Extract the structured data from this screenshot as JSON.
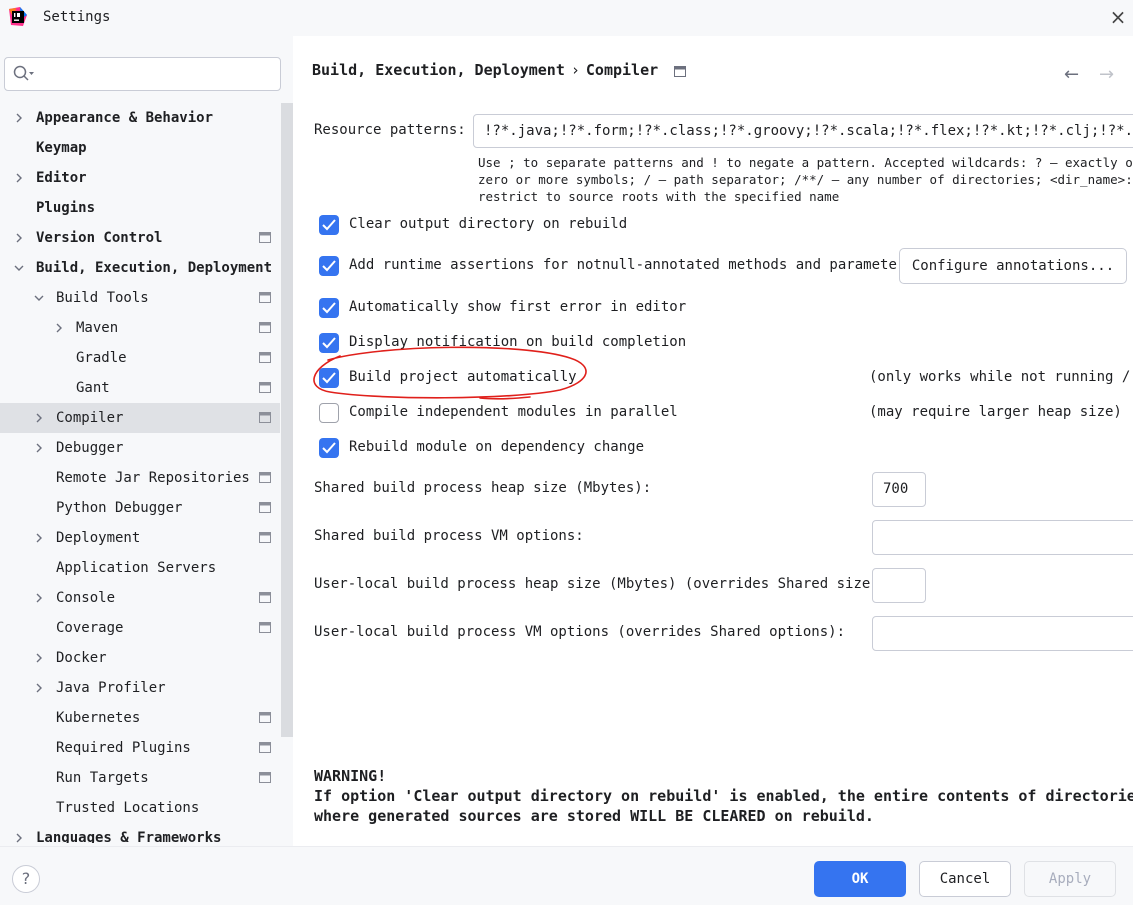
{
  "window": {
    "title": "Settings"
  },
  "search": {
    "placeholder": ""
  },
  "tree": [
    {
      "label": "Appearance & Behavior",
      "bold": true,
      "chevron": "right",
      "indent": 0,
      "proj": false,
      "selected": false
    },
    {
      "label": "Keymap",
      "bold": true,
      "chevron": "none",
      "indent": 0,
      "proj": false,
      "selected": false
    },
    {
      "label": "Editor",
      "bold": true,
      "chevron": "right",
      "indent": 0,
      "proj": false,
      "selected": false
    },
    {
      "label": "Plugins",
      "bold": true,
      "chevron": "none",
      "indent": 0,
      "proj": false,
      "selected": false
    },
    {
      "label": "Version Control",
      "bold": true,
      "chevron": "right",
      "indent": 0,
      "proj": true,
      "selected": false
    },
    {
      "label": "Build, Execution, Deployment",
      "bold": true,
      "chevron": "down",
      "indent": 0,
      "proj": false,
      "selected": false
    },
    {
      "label": "Build Tools",
      "bold": false,
      "chevron": "down",
      "indent": 1,
      "proj": true,
      "selected": false
    },
    {
      "label": "Maven",
      "bold": false,
      "chevron": "right",
      "indent": 2,
      "proj": true,
      "selected": false
    },
    {
      "label": "Gradle",
      "bold": false,
      "chevron": "none",
      "indent": 2,
      "proj": true,
      "selected": false
    },
    {
      "label": "Gant",
      "bold": false,
      "chevron": "none",
      "indent": 2,
      "proj": true,
      "selected": false
    },
    {
      "label": "Compiler",
      "bold": false,
      "chevron": "right",
      "indent": 1,
      "proj": true,
      "selected": true
    },
    {
      "label": "Debugger",
      "bold": false,
      "chevron": "right",
      "indent": 1,
      "proj": false,
      "selected": false
    },
    {
      "label": "Remote Jar Repositories",
      "bold": false,
      "chevron": "none",
      "indent": 1,
      "proj": true,
      "selected": false
    },
    {
      "label": "Python Debugger",
      "bold": false,
      "chevron": "none",
      "indent": 1,
      "proj": true,
      "selected": false
    },
    {
      "label": "Deployment",
      "bold": false,
      "chevron": "right",
      "indent": 1,
      "proj": true,
      "selected": false
    },
    {
      "label": "Application Servers",
      "bold": false,
      "chevron": "none",
      "indent": 1,
      "proj": false,
      "selected": false
    },
    {
      "label": "Console",
      "bold": false,
      "chevron": "right",
      "indent": 1,
      "proj": true,
      "selected": false
    },
    {
      "label": "Coverage",
      "bold": false,
      "chevron": "none",
      "indent": 1,
      "proj": true,
      "selected": false
    },
    {
      "label": "Docker",
      "bold": false,
      "chevron": "right",
      "indent": 1,
      "proj": false,
      "selected": false
    },
    {
      "label": "Java Profiler",
      "bold": false,
      "chevron": "right",
      "indent": 1,
      "proj": false,
      "selected": false
    },
    {
      "label": "Kubernetes",
      "bold": false,
      "chevron": "none",
      "indent": 1,
      "proj": true,
      "selected": false
    },
    {
      "label": "Required Plugins",
      "bold": false,
      "chevron": "none",
      "indent": 1,
      "proj": true,
      "selected": false
    },
    {
      "label": "Run Targets",
      "bold": false,
      "chevron": "none",
      "indent": 1,
      "proj": true,
      "selected": false
    },
    {
      "label": "Trusted Locations",
      "bold": false,
      "chevron": "none",
      "indent": 1,
      "proj": false,
      "selected": false
    },
    {
      "label": "Languages & Frameworks",
      "bold": true,
      "chevron": "right",
      "indent": 0,
      "proj": false,
      "selected": false
    }
  ],
  "breadcrumb": {
    "parent": "Build, Execution, Deployment",
    "separator": "›",
    "current": "Compiler"
  },
  "resource": {
    "label": "Resource patterns:",
    "value": "!?*.java;!?*.form;!?*.class;!?*.groovy;!?*.scala;!?*.flex;!?*.kt;!?*.clj;!?*.aj",
    "hint_line1": "Use ; to separate patterns and ! to negate a pattern. Accepted wildcards: ? — exactly one sym",
    "hint_line2": "zero or more symbols; / — path separator; /**/ — any number of directories; <dir_name>:<patte",
    "hint_line3": "restrict to source roots with the specified name"
  },
  "options": {
    "clear_output": {
      "label": "Clear output directory on rebuild",
      "checked": true
    },
    "runtime_assertions": {
      "label": "Add runtime assertions for notnull-annotated methods and parameters",
      "checked": true,
      "button": "Configure annotations..."
    },
    "show_first_error": {
      "label": "Automatically show first error in editor",
      "checked": true
    },
    "notify_build": {
      "label": "Display notification on build completion",
      "checked": true
    },
    "build_auto": {
      "label": "Build project automatically",
      "checked": true,
      "note": "(only works while not running / d"
    },
    "parallel": {
      "label": "Compile independent modules in parallel",
      "checked": false,
      "note": "(may require larger heap size)"
    },
    "rebuild_dep": {
      "label": "Rebuild module on dependency change",
      "checked": true
    }
  },
  "fields": {
    "heap_label": "Shared build process heap size (Mbytes):",
    "heap_value": "700",
    "vm_label": "Shared build process VM options:",
    "vm_value": "",
    "user_heap_label": "User-local build process heap size (Mbytes) (overrides Shared size):",
    "user_heap_value": "",
    "user_vm_label": "User-local build process VM options (overrides Shared options):",
    "user_vm_value": ""
  },
  "warning": {
    "line1": "WARNING!",
    "line2": "If option 'Clear output directory on rebuild' is enabled, the entire contents of directorie",
    "line3": "where generated sources are stored WILL BE CLEARED on rebuild."
  },
  "footer": {
    "help": "?",
    "ok": "OK",
    "cancel": "Cancel",
    "apply": "Apply"
  },
  "colors": {
    "accent": "#3574f0",
    "selection": "#dfe1e5",
    "annotation": "#e0201b"
  }
}
